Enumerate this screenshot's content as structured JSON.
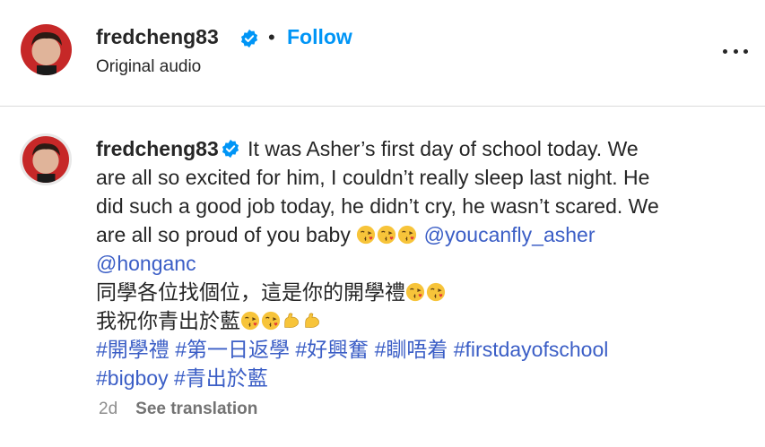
{
  "header": {
    "username": "fredcheng83",
    "separator": "•",
    "follow_label": "Follow",
    "subtitle": "Original audio"
  },
  "comment": {
    "username": "fredcheng83",
    "lines": [
      {
        "text": "It was Asher’s first day of school today. We"
      },
      {
        "text": "are all so excited for him, I couldn’t really sleep last night. He"
      },
      {
        "text": "did such a good job today, he didn’t cry, he wasn’t scared. We"
      },
      {
        "text": "are all so proud of you baby "
      }
    ],
    "mention_1": "@youcanfly_asher",
    "mention_2": "@honganc",
    "chinese_line_1": "同學各位找個位，這是你的開學禮",
    "chinese_line_2": "我祝你青出於藍",
    "hashtags_line_1": [
      "#開學禮",
      "#第一日返學",
      "#好興奮",
      "#瞓唔着",
      "#firstdayofschool"
    ],
    "hashtags_line_2": [
      "#bigboy",
      "#青出於藍"
    ],
    "emoji_icons": [
      "kissing-heart-icon",
      "flexed-biceps-icon"
    ]
  },
  "meta": {
    "time": "2d",
    "see_translation": "See translation"
  },
  "colors": {
    "follow": "#0095f6",
    "link": "#3b5ec6",
    "verified": "#0095f6",
    "muted": "#8e8e8e"
  }
}
